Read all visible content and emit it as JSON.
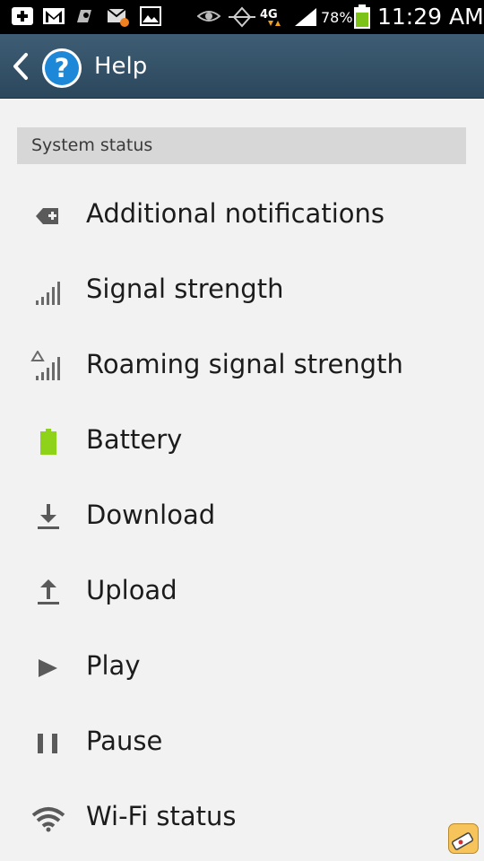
{
  "status_bar": {
    "battery_percent": "78%",
    "time": "11:29 AM",
    "icons": [
      "add-box-icon",
      "gmail-icon",
      "puzzle-icon",
      "missed-email-icon",
      "gallery-icon",
      "eye-icon",
      "signal-booster-icon",
      "4g-lte-icon",
      "cell-signal-icon",
      "battery-icon"
    ]
  },
  "action_bar": {
    "title": "Help",
    "icons": [
      "back-arrow-icon",
      "help-question-icon"
    ]
  },
  "section": {
    "header": "System status"
  },
  "items": [
    {
      "label": "Additional notifications",
      "icon": "additional-notifications-icon"
    },
    {
      "label": "Signal strength",
      "icon": "signal-strength-icon"
    },
    {
      "label": "Roaming signal strength",
      "icon": "roaming-signal-icon"
    },
    {
      "label": "Battery",
      "icon": "battery-icon"
    },
    {
      "label": "Download",
      "icon": "download-icon"
    },
    {
      "label": "Upload",
      "icon": "upload-icon"
    },
    {
      "label": "Play",
      "icon": "play-icon"
    },
    {
      "label": "Pause",
      "icon": "pause-icon"
    },
    {
      "label": "Wi-Fi status",
      "icon": "wifi-icon"
    }
  ],
  "colors": {
    "action_bar": "#2f4b60",
    "battery_green": "#8ed31a",
    "help_icon_blue": "#1e88d8",
    "section_header": "#d7d7d7",
    "background": "#f2f2f2"
  }
}
